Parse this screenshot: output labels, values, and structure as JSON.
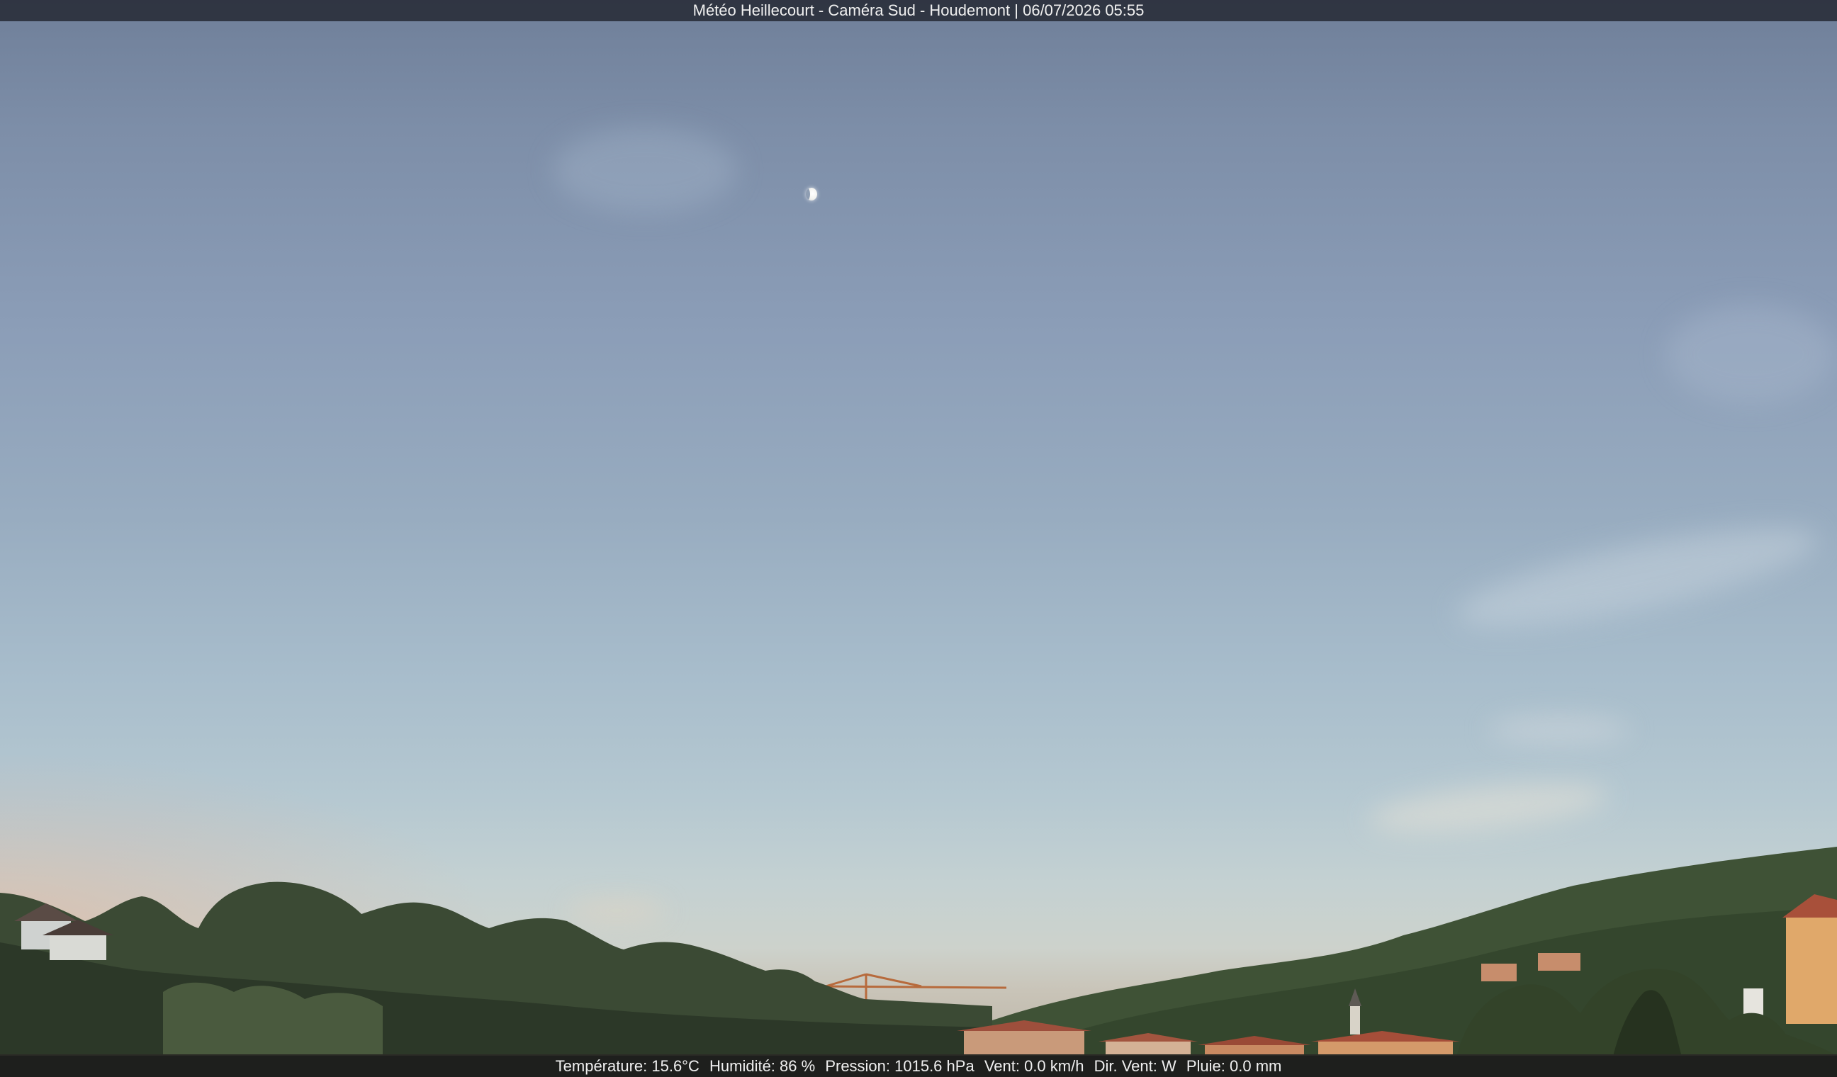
{
  "title_bar": {
    "text": "Météo Heillecourt - Caméra Sud - Houdemont | 06/07/2026 05:55"
  },
  "info_bar": {
    "temperature": "Température: 15.6°C",
    "humidity": "Humidité: 86 %",
    "pressure": "Pression: 1015.6 hPa",
    "wind": "Vent: 0.0 km/h",
    "wind_dir": "Dir. Vent: W",
    "rain": "Pluie: 0.0 mm"
  }
}
